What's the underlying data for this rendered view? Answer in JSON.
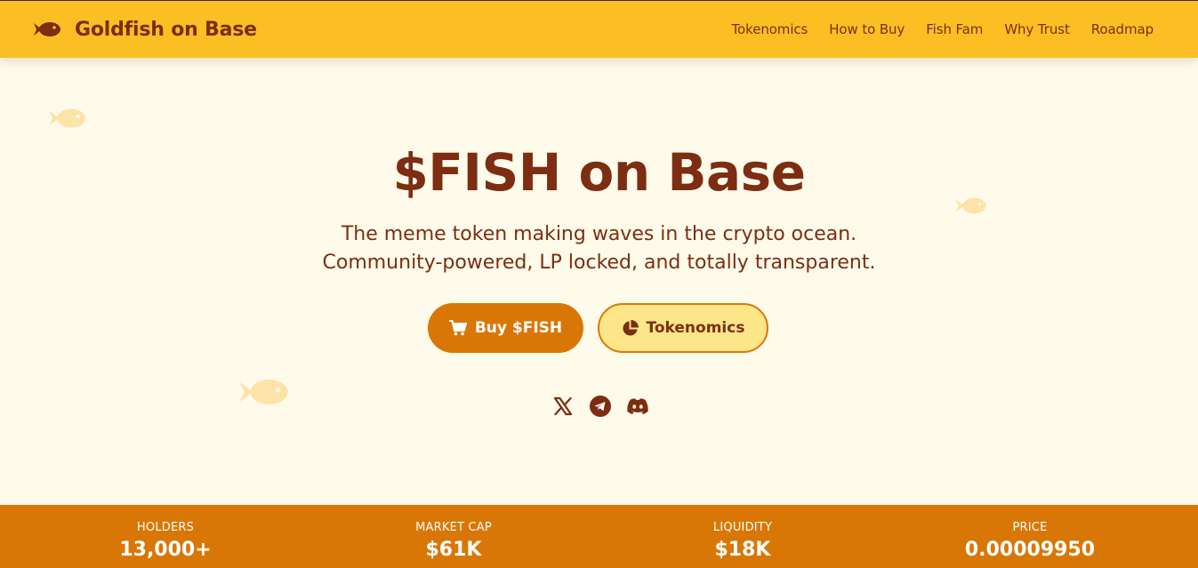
{
  "colors": {
    "background": "#fffbea",
    "navbar": "#fbbf24",
    "accent": "#d97706",
    "text_brown": "#7c2d12",
    "secondary_button": "#fde68a",
    "decor_fish": "#fde3a7"
  },
  "navbar": {
    "logo_icon": "fish-icon",
    "brand": "Goldfish on Base",
    "links": [
      "Tokenomics",
      "How to Buy",
      "Fish Fam",
      "Why Trust",
      "Roadmap"
    ]
  },
  "hero": {
    "title": "$FISH on Base",
    "subtitle_line1": "The meme token making waves in the crypto ocean.",
    "subtitle_line2": "Community-powered, LP locked, and totally transparent.",
    "buy_button": {
      "icon": "cart-icon",
      "label": "Buy $FISH"
    },
    "tokenomics_button": {
      "icon": "pie-chart-icon",
      "label": "Tokenomics"
    },
    "socials": [
      "x-icon",
      "telegram-icon",
      "discord-icon"
    ]
  },
  "stats": [
    {
      "label": "HOLDERS",
      "value": "13,000+"
    },
    {
      "label": "MARKET CAP",
      "value": "$61K"
    },
    {
      "label": "LIQUIDITY",
      "value": "$18K"
    },
    {
      "label": "PRICE",
      "value": "0.00009950"
    }
  ]
}
